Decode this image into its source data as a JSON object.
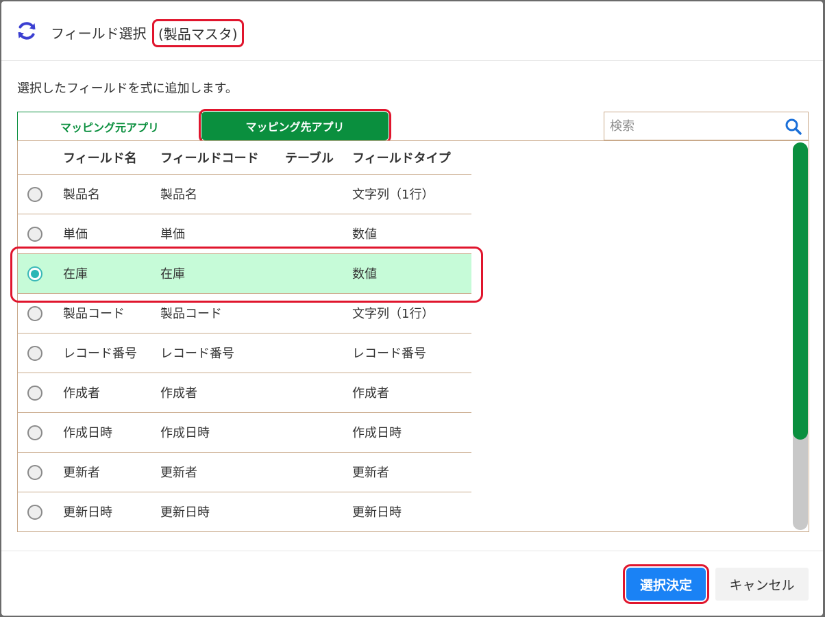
{
  "dialog": {
    "title": "フィールド選択",
    "app_name": "(製品マスタ)",
    "description": "選択したフィールドを式に追加します。"
  },
  "tabs": [
    {
      "label": "マッピング元アプリ",
      "active": false
    },
    {
      "label": "マッピング先アプリ",
      "active": true
    }
  ],
  "search": {
    "placeholder": "検索",
    "value": ""
  },
  "table": {
    "headers": [
      "フィールド名",
      "フィールドコード",
      "テーブル",
      "フィールドタイプ"
    ],
    "rows": [
      {
        "name": "製品名",
        "code": "製品名",
        "table": "",
        "type": "文字列（1行）",
        "selected": false
      },
      {
        "name": "単価",
        "code": "単価",
        "table": "",
        "type": "数値",
        "selected": false
      },
      {
        "name": "在庫",
        "code": "在庫",
        "table": "",
        "type": "数値",
        "selected": true
      },
      {
        "name": "製品コード",
        "code": "製品コード",
        "table": "",
        "type": "文字列（1行）",
        "selected": false
      },
      {
        "name": "レコード番号",
        "code": "レコード番号",
        "table": "",
        "type": "レコード番号",
        "selected": false
      },
      {
        "name": "作成者",
        "code": "作成者",
        "table": "",
        "type": "作成者",
        "selected": false
      },
      {
        "name": "作成日時",
        "code": "作成日時",
        "table": "",
        "type": "作成日時",
        "selected": false
      },
      {
        "name": "更新者",
        "code": "更新者",
        "table": "",
        "type": "更新者",
        "selected": false
      },
      {
        "name": "更新日時",
        "code": "更新日時",
        "table": "",
        "type": "更新日時",
        "selected": false
      }
    ]
  },
  "buttons": {
    "ok": "選択決定",
    "cancel": "キャンセル"
  },
  "colors": {
    "accent_green": "#0a8f3e",
    "primary_blue": "#1a82f5",
    "selected_row": "#c6fbd8",
    "highlight_red": "#e0152d",
    "icon_blue": "#3b3fd1"
  },
  "icons": {
    "title": "refresh-icon",
    "search": "search-icon"
  }
}
